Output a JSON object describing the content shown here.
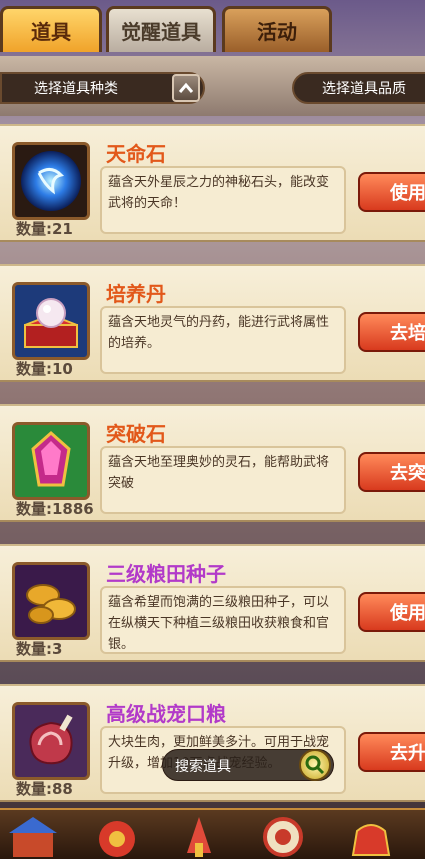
{
  "tabs": [
    {
      "label": "道具",
      "active": true
    },
    {
      "label": "觉醒道具",
      "active": false
    },
    {
      "label": "活动",
      "active": false
    }
  ],
  "filters": {
    "type_label": "选择道具种类",
    "quality_label": "选择道具品质"
  },
  "items": [
    {
      "name": "天命石",
      "name_color": "orange",
      "description": "蕴含天外星辰之力的神秘石头，能改变武将的天命！",
      "quantity": "数量:21",
      "action": "使用",
      "icon": "blue-orb-icon"
    },
    {
      "name": "培养丹",
      "name_color": "orange",
      "description": "蕴含天地灵气的丹药，能进行武将属性的培养。",
      "quantity": "数量:10",
      "action": "去培养",
      "icon": "pearl-chest-icon"
    },
    {
      "name": "突破石",
      "name_color": "orange",
      "description": "蕴含天地至理奥妙的灵石，能帮助武将突破",
      "quantity": "数量:1886",
      "action": "去突破",
      "icon": "pink-gem-icon"
    },
    {
      "name": "三级粮田种子",
      "name_color": "purple",
      "description": "蕴含希望而饱满的三级粮田种子，可以在纵横天下种植三级粮田收获粮食和官银。",
      "quantity": "数量:3",
      "action": "使用",
      "icon": "seeds-icon"
    },
    {
      "name": "高级战宠口粮",
      "name_color": "purple",
      "description": "大块生肉，更加鲜美多汁。可用于战宠升级，增加10万点战宠经验。",
      "quantity": "数量:88",
      "action": "去升级",
      "icon": "meat-icon"
    }
  ],
  "search": {
    "label": "搜索道具"
  },
  "colors": {
    "accent": "#e2581a",
    "purple": "#b23ac9",
    "button": "#d83a1e"
  }
}
